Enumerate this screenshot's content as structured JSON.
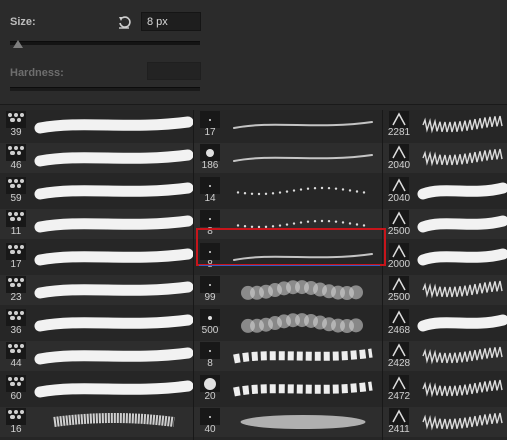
{
  "controls": {
    "size_label": "Size:",
    "size_value": "8 px",
    "hardness_label": "Hardness:",
    "size_slider_level": 0.04
  },
  "brushes": {
    "col1": [
      "39",
      "46",
      "59",
      "11",
      "17",
      "23",
      "36",
      "44",
      "60",
      "16"
    ],
    "col2": [
      "17",
      "186",
      "14",
      "8",
      "8",
      "99",
      "500",
      "8",
      "20",
      "40"
    ],
    "col3": [
      "2281",
      "2040",
      "2040",
      "2500",
      "2000",
      "2500",
      "2468",
      "2428",
      "2472",
      "2411"
    ],
    "selected_index": 4,
    "selected_column": 2
  }
}
